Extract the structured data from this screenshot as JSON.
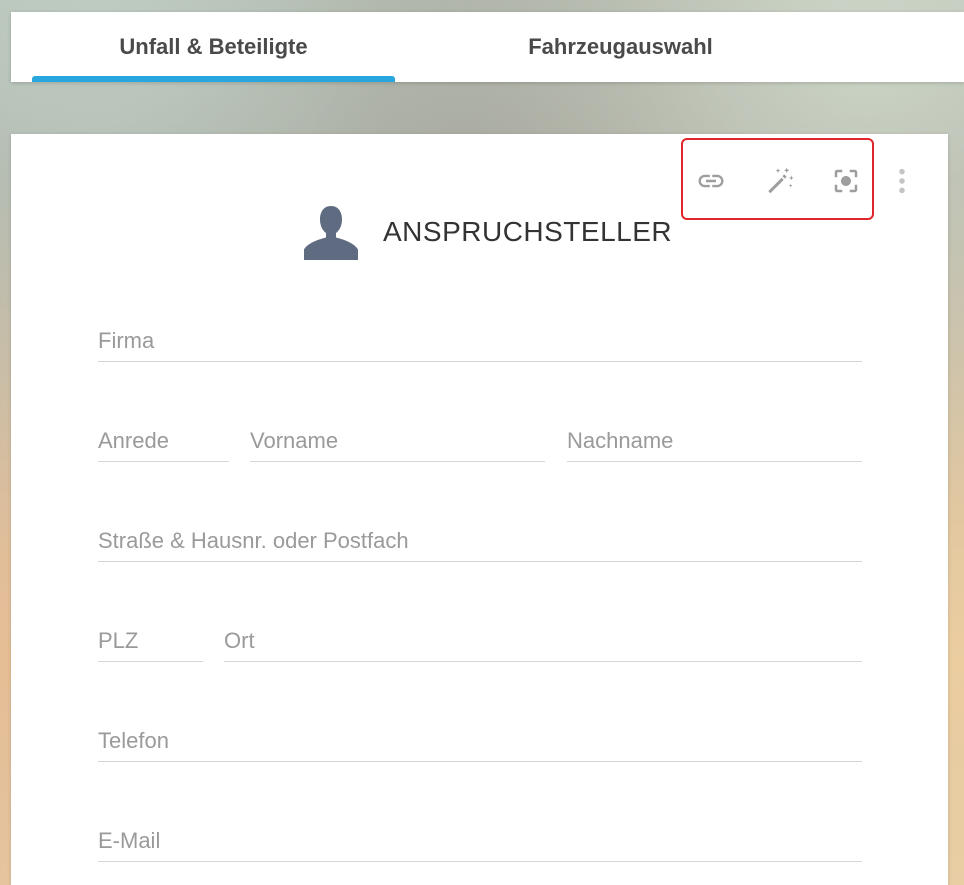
{
  "tabs": [
    {
      "label": "Unfall & Beteiligte",
      "active": true
    },
    {
      "label": "Fahrzeugauswahl",
      "active": false
    }
  ],
  "colors": {
    "accent": "#2aa6de",
    "highlight_border": "#e0262b",
    "icon_gray": "#9e9e9e",
    "person_icon": "#5e6b80"
  },
  "toolbar": {
    "icons": [
      "link-icon",
      "magic-wand-icon",
      "focus-icon",
      "more-vert-icon"
    ]
  },
  "section": {
    "icon": "person-icon",
    "title": "ANSPRUCHSTELLER"
  },
  "form": {
    "firma": {
      "placeholder": "Firma",
      "value": ""
    },
    "anrede": {
      "placeholder": "Anrede",
      "value": ""
    },
    "vorname": {
      "placeholder": "Vorname",
      "value": ""
    },
    "nachname": {
      "placeholder": "Nachname",
      "value": ""
    },
    "strasse": {
      "placeholder": "Straße & Hausnr. oder Postfach",
      "value": ""
    },
    "plz": {
      "placeholder": "PLZ",
      "value": ""
    },
    "ort": {
      "placeholder": "Ort",
      "value": ""
    },
    "telefon": {
      "placeholder": "Telefon",
      "value": ""
    },
    "email": {
      "placeholder": "E-Mail",
      "value": ""
    }
  }
}
